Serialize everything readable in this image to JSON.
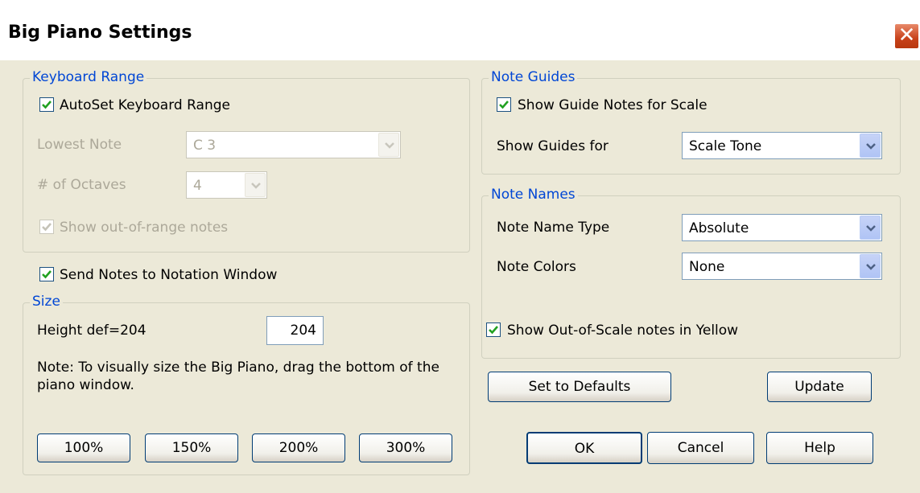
{
  "window": {
    "title": "Big Piano Settings",
    "close_glyph": "✕"
  },
  "keyboard_range": {
    "legend": "Keyboard Range",
    "autoset_label": "AutoSet Keyboard Range",
    "autoset_checked": true,
    "lowest_note_label": "Lowest Note",
    "lowest_note_value": "C 3",
    "octaves_label": "# of Octaves",
    "octaves_value": "4",
    "out_of_range_label": "Show out-of-range notes",
    "out_of_range_checked": true
  },
  "send_notes": {
    "label": "Send Notes to Notation Window",
    "checked": true
  },
  "size": {
    "legend": "Size",
    "height_label": "Height def=204",
    "height_value": "204",
    "note": "Note: To visually size the Big Piano, drag the bottom of the piano window.",
    "buttons": [
      "100%",
      "150%",
      "200%",
      "300%"
    ]
  },
  "note_guides": {
    "legend": "Note Guides",
    "show_guide_label": "Show Guide Notes for Scale",
    "show_guide_checked": true,
    "guides_for_label": "Show Guides for",
    "guides_for_value": "Scale Tone"
  },
  "note_names": {
    "legend": "Note Names",
    "type_label": "Note Name Type",
    "type_value": "Absolute",
    "colors_label": "Note Colors",
    "colors_value": "None"
  },
  "out_of_scale": {
    "label": "Show Out-of-Scale notes in Yellow",
    "checked": true
  },
  "buttons": {
    "defaults": "Set to Defaults",
    "update": "Update",
    "ok": "OK",
    "cancel": "Cancel",
    "help": "Help"
  },
  "colors": {
    "legend": "#0046d5",
    "close": "#c8421b",
    "check": "#21a121"
  }
}
